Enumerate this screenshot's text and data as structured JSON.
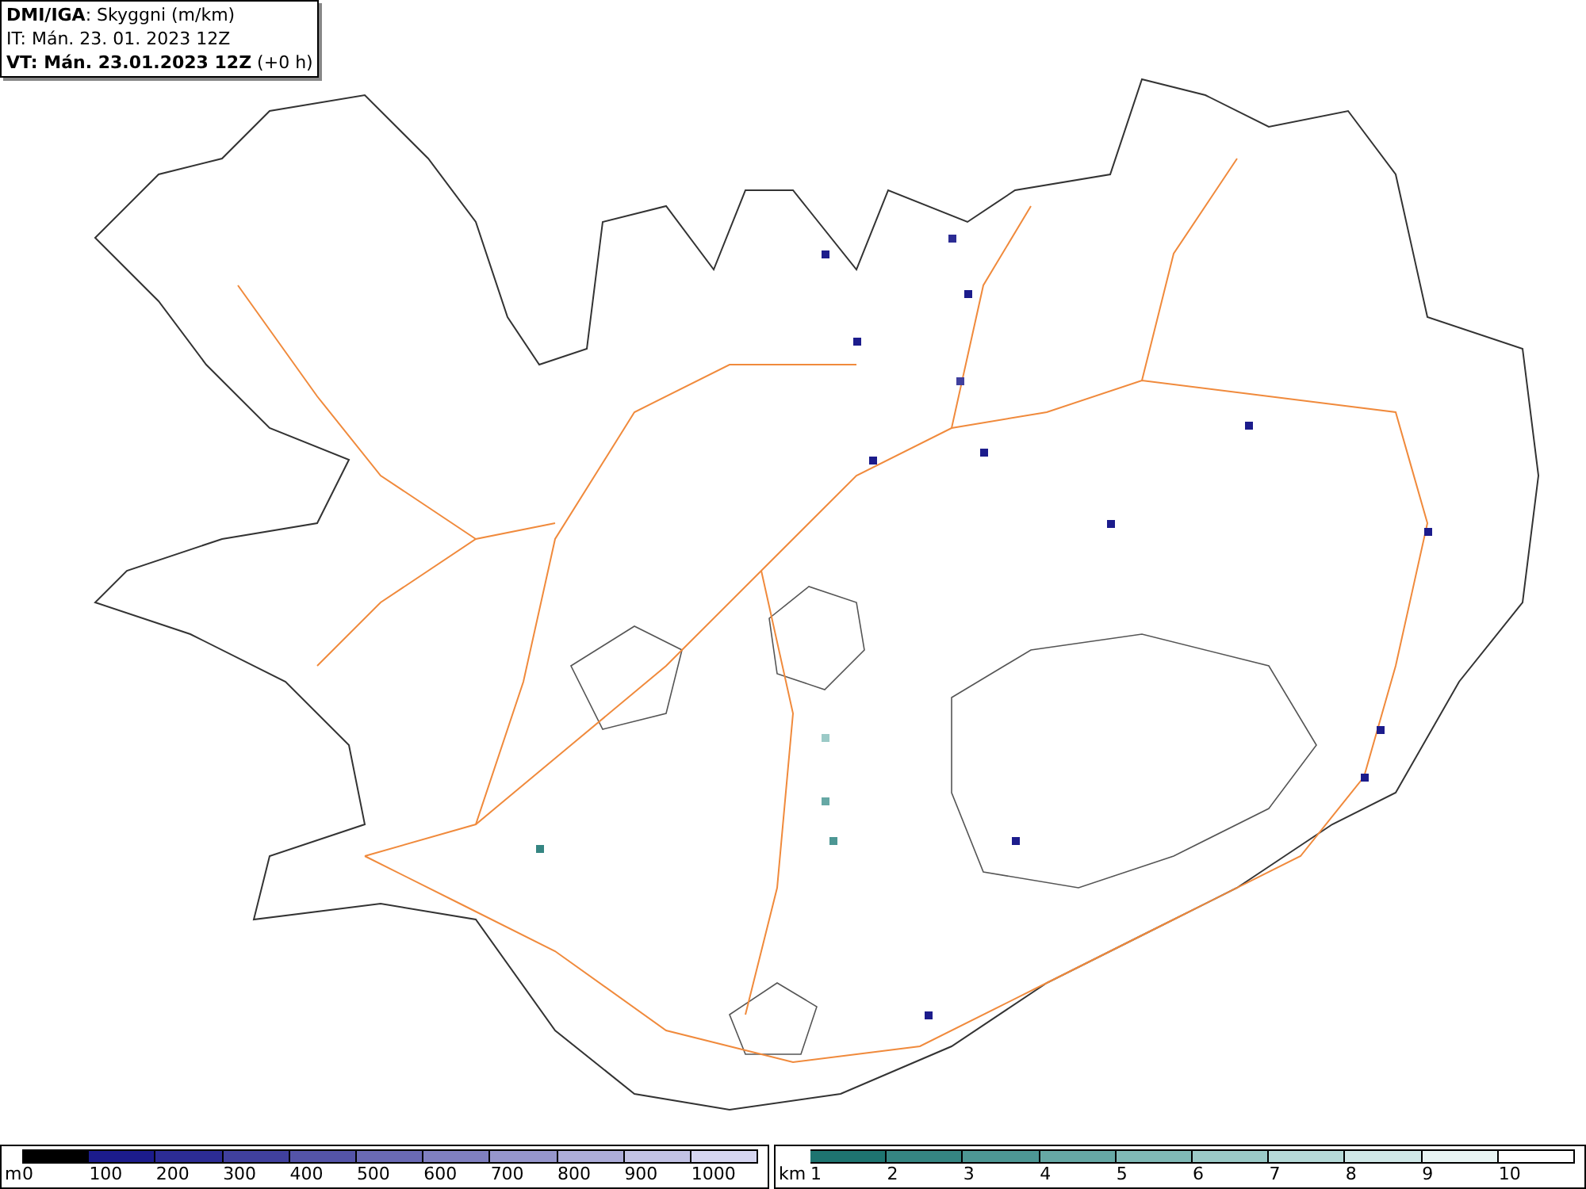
{
  "header": {
    "lines": [
      "**DMI/IGA**: Skyggni (m/km)",
      "IT: Mán. 23. 01. 2023 12Z",
      "**VT: Mán. 23.01.2023 12Z** (+0 h)"
    ]
  },
  "legends": [
    {
      "unit": "m",
      "steps": [
        {
          "label": "0",
          "color": "#000000"
        },
        {
          "label": "100",
          "color": "#1c1c8c"
        },
        {
          "label": "200",
          "color": "#2c2c94"
        },
        {
          "label": "300",
          "color": "#40409e"
        },
        {
          "label": "400",
          "color": "#5454a8"
        },
        {
          "label": "500",
          "color": "#6a6ab4"
        },
        {
          "label": "600",
          "color": "#8080c0"
        },
        {
          "label": "700",
          "color": "#9696cc"
        },
        {
          "label": "800",
          "color": "#acacd8"
        },
        {
          "label": "900",
          "color": "#c2c2e4"
        },
        {
          "label": "1000",
          "color": "#d6d6f0"
        }
      ]
    },
    {
      "unit": "km",
      "steps": [
        {
          "label": "1",
          "color": "#1e7470"
        },
        {
          "label": "2",
          "color": "#358582"
        },
        {
          "label": "3",
          "color": "#4d9794"
        },
        {
          "label": "4",
          "color": "#66a8a5"
        },
        {
          "label": "5",
          "color": "#80b9b6"
        },
        {
          "label": "6",
          "color": "#9bcac7"
        },
        {
          "label": "7",
          "color": "#b6dad8"
        },
        {
          "label": "8",
          "color": "#d0e8e7"
        },
        {
          "label": "9",
          "color": "#e8f4f3"
        },
        {
          "label": "10",
          "color": "#ffffff"
        }
      ]
    }
  ]
}
